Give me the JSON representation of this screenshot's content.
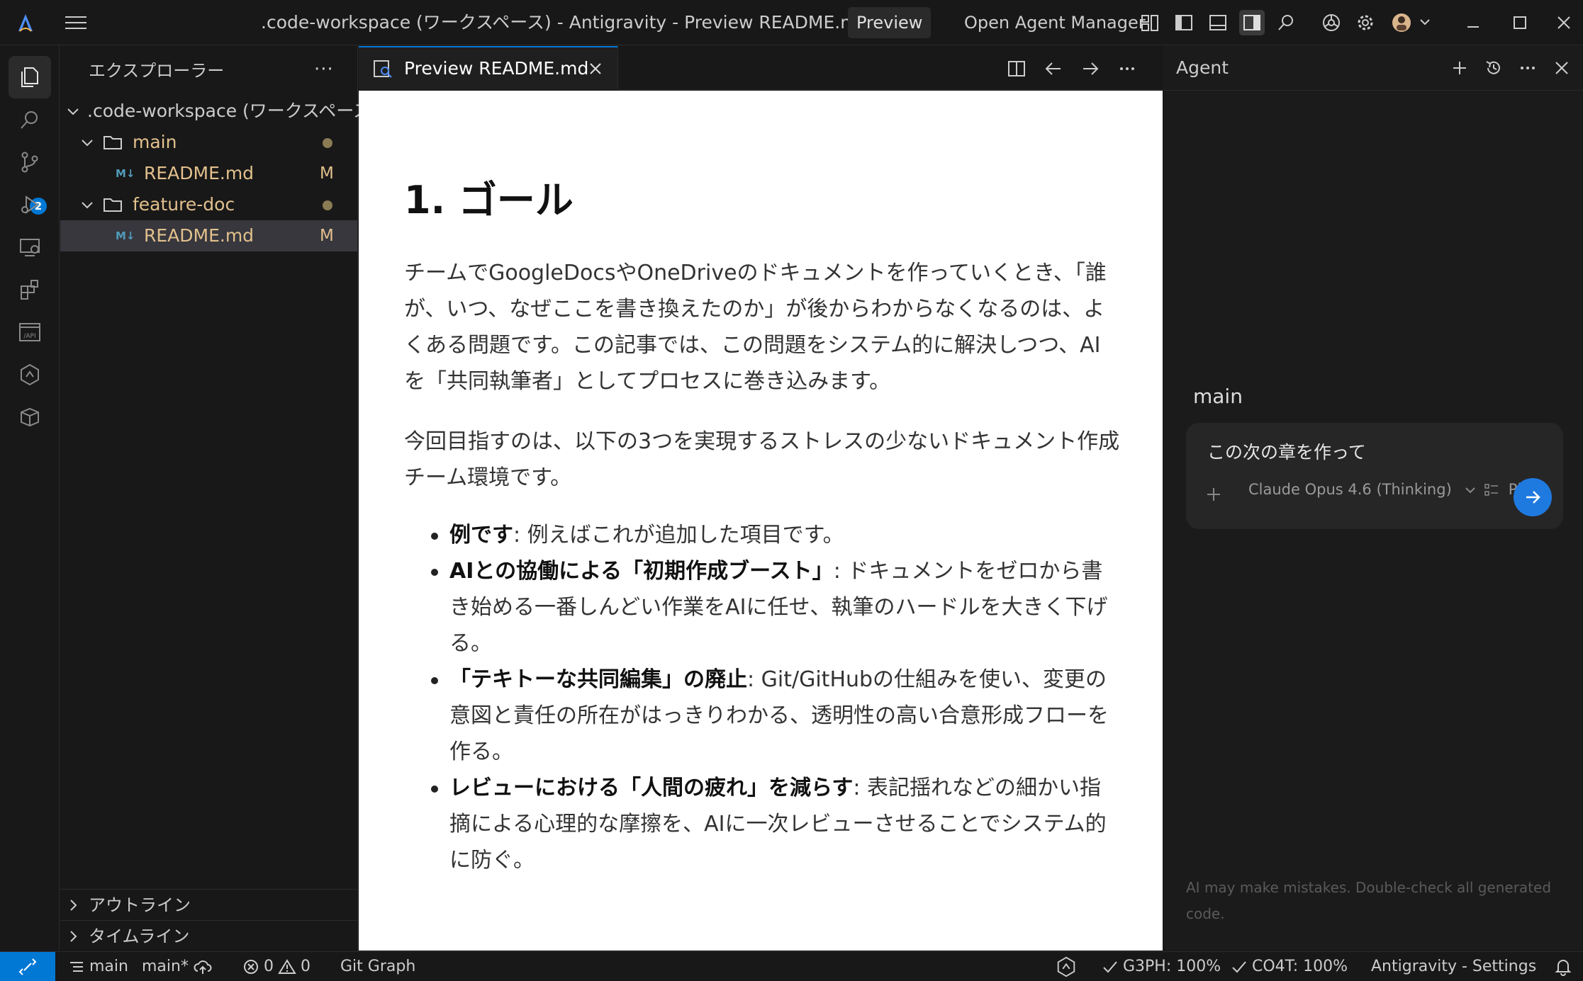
{
  "titlebar": {
    "title": ".code-workspace (ワークスペース) - Antigravity - Preview README.md",
    "preview_button": "Preview",
    "open_agent_manager": "Open Agent Manager"
  },
  "activitybar": {
    "scm_badge": "2"
  },
  "sidebar": {
    "header": "エクスプローラー",
    "more": "···",
    "workspace": ".code-workspace (ワークスペース)",
    "items": [
      {
        "type": "folder",
        "label": "main"
      },
      {
        "type": "file",
        "icon": "M↓",
        "label": "README.md",
        "status": "M"
      },
      {
        "type": "folder",
        "label": "feature-doc"
      },
      {
        "type": "file",
        "icon": "M↓",
        "label": "README.md",
        "status": "M"
      }
    ],
    "outline": "アウトライン",
    "timeline": "タイムライン"
  },
  "editor": {
    "tab_label": "Preview README.md"
  },
  "preview": {
    "heading": "1. ゴール",
    "para1": "チームでGoogleDocsやOneDriveのドキュメントを作っていくとき、「誰が、いつ、なぜここを書き換えたのか」が後からわからなくなるのは、よくある問題です。この記事では、この問題をシステム的に解決しつつ、AIを「共同執筆者」としてプロセスに巻き込みます。",
    "para2": "今回目指すのは、以下の3つを実現するストレスの少ないドキュメント作成チーム環境です。",
    "bullets": [
      {
        "bold": "例です",
        "text": ": 例えばこれが追加した項目です。"
      },
      {
        "bold": "AIとの協働による「初期作成ブースト」",
        "text": ": ドキュメントをゼロから書き始める一番しんどい作業をAIに任せ、執筆のハードルを大きく下げる。"
      },
      {
        "bold": "「テキトーな共同編集」の廃止",
        "text": ": Git/GitHubの仕組みを使い、変更の意図と責任の所在がはっきりわかる、透明性の高い合意形成フローを作る。"
      },
      {
        "bold": "レビューにおける「人間の疲れ」を減らす",
        "text": ": 表記揺れなどの細かい指摘による心理的な摩擦を、AIに一次レビューさせることでシステム的に防ぐ。"
      }
    ]
  },
  "agent": {
    "title": "Agent",
    "branch": "main",
    "input_text": "この次の章を作って",
    "model": "Claude Opus 4.6 (Thinking)",
    "plan": "Plan",
    "disclaimer": "AI may make mistakes. Double-check all generated code."
  },
  "statusbar": {
    "branch": "main",
    "branch_dirty": "main*",
    "errors": "0",
    "warnings": "0",
    "git_graph": "Git Graph",
    "quota1": "G3PH: 100%",
    "quota2": "CO4T: 100%",
    "settings": "Antigravity - Settings"
  },
  "colors": {
    "accent": "#0078d4",
    "modified": "#e2c08d",
    "background": "#181818"
  }
}
